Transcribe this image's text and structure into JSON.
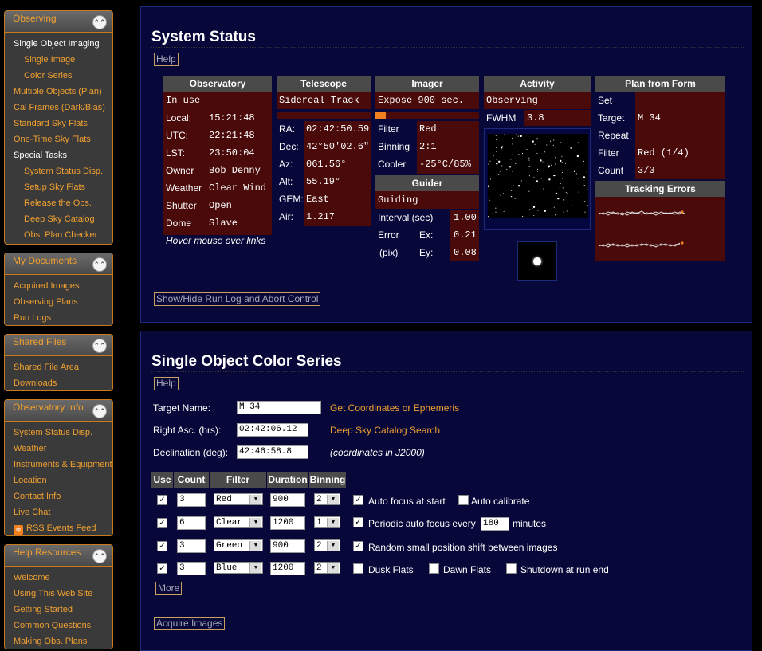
{
  "sidebar": {
    "observing": {
      "title": "Observing",
      "items": [
        "Single Object Imaging",
        "Single Image",
        "Color Series",
        "Multiple Objects (Plan)",
        "Cal Frames (Dark/Bias)",
        "Standard Sky Flats",
        "One-Time Sky Flats",
        "Special Tasks",
        "System Status Disp.",
        "Setup Sky Flats",
        "Release the Obs.",
        "Deep Sky Catalog",
        "Obs. Plan Checker"
      ]
    },
    "documents": {
      "title": "My Documents",
      "items": [
        "Acquired Images",
        "Observing Plans",
        "Run Logs"
      ]
    },
    "shared": {
      "title": "Shared Files",
      "items": [
        "Shared File Area",
        "Downloads"
      ]
    },
    "info": {
      "title": "Observatory Info",
      "items": [
        "System Status Disp.",
        "Weather",
        "Instruments & Equipment",
        "Location",
        "Contact Info",
        "Live Chat",
        "RSS Events Feed"
      ]
    },
    "help": {
      "title": "Help Resources",
      "items": [
        "Welcome",
        "Using This Web Site",
        "Getting Started",
        "Common Questions",
        "Making Obs. Plans"
      ]
    }
  },
  "status": {
    "title": "System Status",
    "help": "Help",
    "observatory": {
      "header": "Observatory",
      "state": "In use",
      "rows": [
        [
          "Local:",
          "15:21:48"
        ],
        [
          "UTC:",
          "22:21:48"
        ],
        [
          "LST:",
          "23:50:04"
        ],
        [
          "Owner",
          "Bob Denny"
        ],
        [
          "Weather",
          "Clear Wind"
        ],
        [
          "Shutter",
          "Open"
        ],
        [
          "Dome",
          "Slave"
        ]
      ],
      "hover_note": "Hover mouse over links"
    },
    "telescope": {
      "header": "Telescope",
      "state": "Sidereal Track",
      "rows": [
        [
          "RA:",
          "02:42:50.59"
        ],
        [
          "Dec:",
          "42°50'02.6\""
        ],
        [
          "Az:",
          "061.56°"
        ],
        [
          "Alt:",
          "55.19°"
        ],
        [
          "GEM:",
          "East"
        ],
        [
          "Air:",
          "1.217"
        ]
      ]
    },
    "imager": {
      "header": "Imager",
      "state": "Expose 900 sec.",
      "progress": 0.1,
      "rows": [
        [
          "Filter",
          "Red"
        ],
        [
          "Binning",
          "2:1"
        ],
        [
          "Cooler",
          "-25°C/85%"
        ]
      ]
    },
    "guider": {
      "header": "Guider",
      "state": "Guiding",
      "interval_label": "Interval (sec)",
      "interval": "1.00",
      "error_label": "Error",
      "pix_label": "(pix)",
      "ex_label": "Ex:",
      "ex": "0.21",
      "ey_label": "Ey:",
      "ey": "0.08"
    },
    "activity": {
      "header": "Activity",
      "state": "Observing",
      "fwhm_label": "FWHM",
      "fwhm": "3.8"
    },
    "plan": {
      "header": "Plan from Form",
      "rows": [
        [
          "Set",
          ""
        ],
        [
          "Target",
          "M 34"
        ],
        [
          "Repeat",
          ""
        ],
        [
          "Filter",
          "Red (1/4)"
        ],
        [
          "Count",
          "3/3"
        ]
      ]
    },
    "tracking": {
      "header": "Tracking Errors"
    },
    "run_log_button": "Show/Hide Run Log and Abort Control"
  },
  "series": {
    "title": "Single Object Color Series",
    "help": "Help",
    "target_label": "Target Name:",
    "target": "M 34",
    "ra_label": "Right Asc. (hrs):",
    "ra": "02:42:06.12",
    "dec_label": "Declination (deg):",
    "dec": "42:46:58.8",
    "get_coords": "Get Coordinates or Ephemeris",
    "catalog_search": "Deep Sky Catalog Search",
    "j2000_note": "(coordinates in J2000)",
    "headers": [
      "Use",
      "Count",
      "Filter",
      "Duration",
      "Binning"
    ],
    "rows": [
      {
        "use": true,
        "count": "3",
        "filter": "Red",
        "duration": "900",
        "binning": "2"
      },
      {
        "use": true,
        "count": "6",
        "filter": "Clear",
        "duration": "1200",
        "binning": "1"
      },
      {
        "use": true,
        "count": "3",
        "filter": "Green",
        "duration": "900",
        "binning": "2"
      },
      {
        "use": true,
        "count": "3",
        "filter": "Blue",
        "duration": "1200",
        "binning": "2"
      }
    ],
    "options": {
      "auto_focus_start": "Auto focus at start",
      "auto_calibrate": "Auto calibrate",
      "periodic_focus": "Periodic auto focus every",
      "periodic_minutes": "180",
      "minutes": "minutes",
      "random_shift": "Random small position shift between images",
      "dusk_flats": "Dusk Flats",
      "dawn_flats": "Dawn Flats",
      "shutdown": "Shutdown at run end"
    },
    "more_button": "More",
    "acquire_button": "Acquire Images"
  }
}
